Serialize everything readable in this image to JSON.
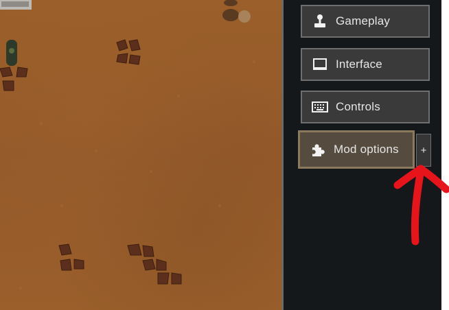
{
  "menu": {
    "items": [
      {
        "label": "Gameplay",
        "icon": "joystick-icon",
        "active": false
      },
      {
        "label": "Interface",
        "icon": "monitor-icon",
        "active": false
      },
      {
        "label": "Controls",
        "icon": "keyboard-icon",
        "active": false
      },
      {
        "label": "Mod options",
        "icon": "puzzle-icon",
        "active": true
      }
    ],
    "expand_label": "+"
  },
  "colors": {
    "panel_bg": "#15181b",
    "button_bg": "#3a3a3a",
    "button_border": "#6f6f6f",
    "active_bg": "#554b3e",
    "active_border": "#8c7a5f",
    "terrain": "#9a5f2a",
    "annotation_arrow": "#e8141b"
  }
}
